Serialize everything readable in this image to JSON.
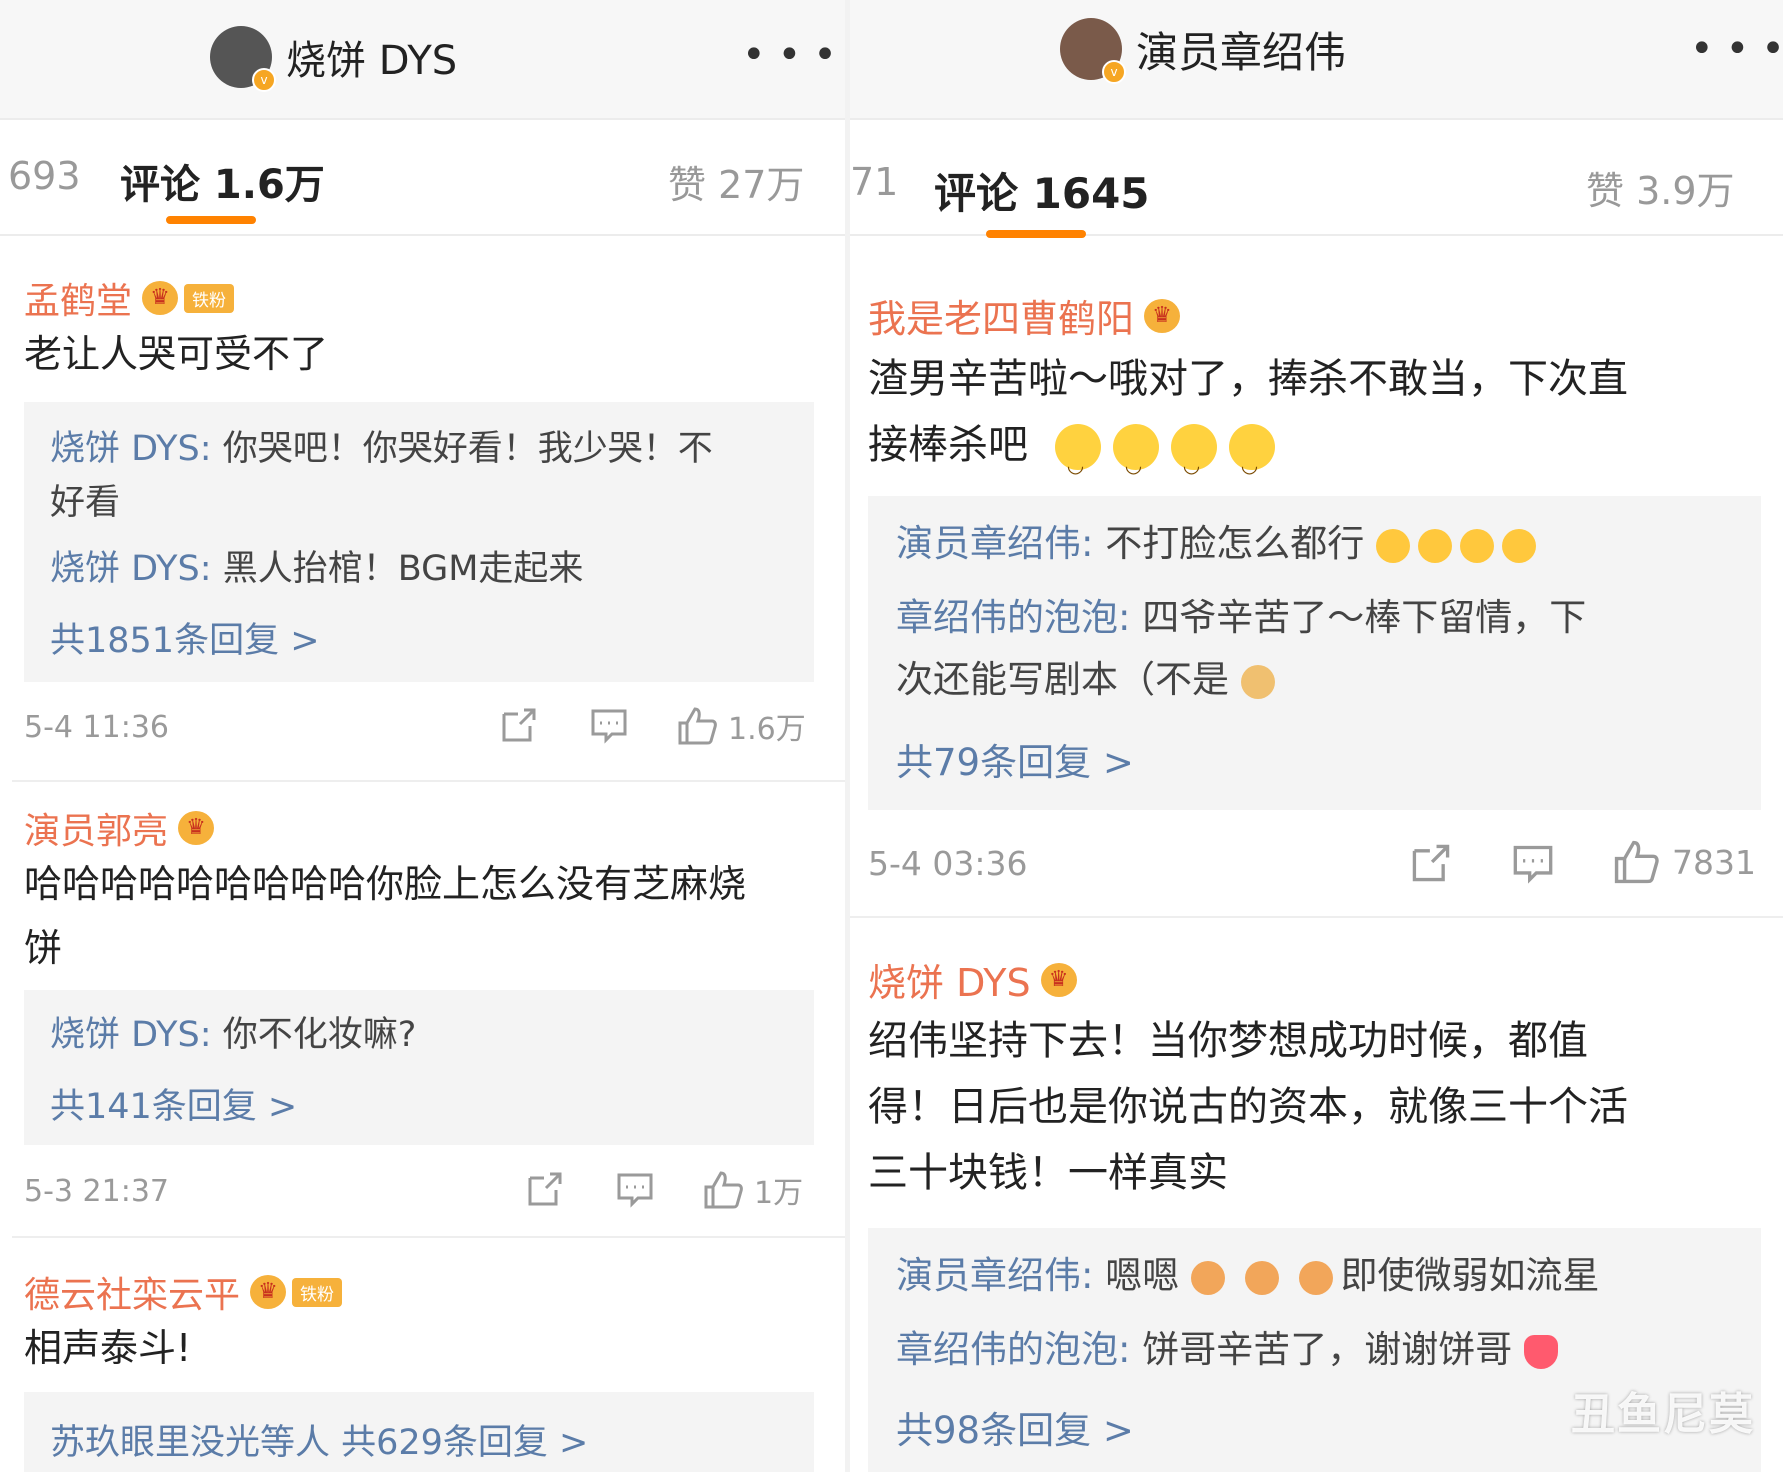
{
  "left": {
    "header": {
      "username": "烧饼 DYS",
      "more": "•••"
    },
    "tabs": {
      "reposts": "693",
      "comments": "评论 1.6万",
      "likes": "赞 27万"
    },
    "comments": [
      {
        "author": "孟鹤堂",
        "badge": "铁粉",
        "text": "老让人哭可受不了",
        "replies": [
          {
            "name": "烧饼 DYS:",
            "text": " 你哭吧！你哭好看！我少哭！不"
          },
          {
            "name": "",
            "text": "好看"
          },
          {
            "name": "烧饼 DYS:",
            "text": " 黑人抬棺！BGM走起来"
          }
        ],
        "more": "共1851条回复 >",
        "time": "5-4 11:36",
        "likes": "1.6万"
      },
      {
        "author": "演员郭亮",
        "badge": "",
        "text_line1": "哈哈哈哈哈哈哈哈哈你脸上怎么没有芝麻烧",
        "text_line2": "饼",
        "replies": [
          {
            "name": "烧饼 DYS:",
            "text": " 你不化妆嘛?"
          }
        ],
        "more": "共141条回复 >",
        "time": "5-3 21:37",
        "likes": "1万"
      },
      {
        "author": "德云社栾云平",
        "badge": "铁粉",
        "text": "相声泰斗!",
        "more": "苏玖眼里没光等人  共629条回复 >"
      }
    ]
  },
  "right": {
    "header": {
      "username": "演员章绍伟",
      "more": "•••"
    },
    "tabs": {
      "reposts": "71",
      "comments": "评论 1645",
      "likes": "赞 3.9万"
    },
    "comments": [
      {
        "author": "我是老四曹鹤阳",
        "text_line1": "渣男辛苦啦～哦对了，捧杀不敢当，下次直",
        "text_line2": "接棒杀吧",
        "replies": [
          {
            "name": "演员章绍伟:",
            "text": " 不打脸怎么都行"
          },
          {
            "name": "章绍伟的泡泡:",
            "text": " 四爷辛苦了～棒下留情，下"
          },
          {
            "name": "",
            "text": "次还能写剧本（不是"
          }
        ],
        "more": "共79条回复 >",
        "time": "5-4 03:36",
        "likes": "7831"
      },
      {
        "author": "烧饼 DYS",
        "text_line1": "绍伟坚持下去！当你梦想成功时候，都值",
        "text_line2": "得！日后也是你说古的资本，就像三十个活",
        "text_line3": "三十块钱！一样真实",
        "replies": [
          {
            "name": "演员章绍伟:",
            "text": " 嗯嗯",
            "tail": "即使微弱如流星"
          },
          {
            "name": "章绍伟的泡泡:",
            "text": " 饼哥辛苦了，谢谢饼哥"
          }
        ],
        "more": "共98条回复 >"
      }
    ],
    "watermark": "丑鱼尼莫"
  },
  "colors": {
    "accent": "#ff8200",
    "name": "#eb7350",
    "link": "#5b7ca8"
  }
}
